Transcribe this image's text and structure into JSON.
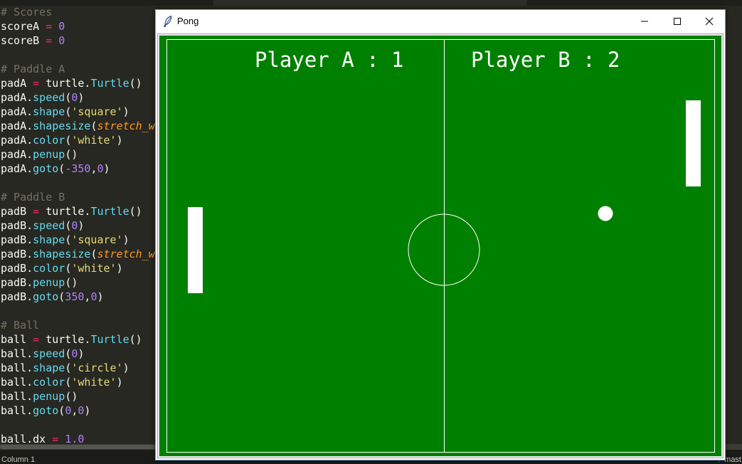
{
  "editor": {
    "code": [
      [
        [
          "cm",
          "# Scores"
        ]
      ],
      [
        [
          "id",
          "scoreA"
        ],
        [
          "p",
          " "
        ],
        [
          "op",
          "="
        ],
        [
          "p",
          " "
        ],
        [
          "num",
          "0"
        ]
      ],
      [
        [
          "id",
          "scoreB"
        ],
        [
          "p",
          " "
        ],
        [
          "op",
          "="
        ],
        [
          "p",
          " "
        ],
        [
          "num",
          "0"
        ]
      ],
      [],
      [
        [
          "cm",
          "# Paddle A"
        ]
      ],
      [
        [
          "id",
          "padA"
        ],
        [
          "p",
          " "
        ],
        [
          "op",
          "="
        ],
        [
          "p",
          " turtle."
        ],
        [
          "fn",
          "Turtle"
        ],
        [
          "p",
          "()"
        ]
      ],
      [
        [
          "id",
          "padA."
        ],
        [
          "fn",
          "speed"
        ],
        [
          "p",
          "("
        ],
        [
          "num",
          "0"
        ],
        [
          "p",
          ")"
        ]
      ],
      [
        [
          "id",
          "padA."
        ],
        [
          "fn",
          "shape"
        ],
        [
          "p",
          "("
        ],
        [
          "str",
          "'square'"
        ],
        [
          "p",
          ")"
        ]
      ],
      [
        [
          "id",
          "padA."
        ],
        [
          "fn",
          "shapesize"
        ],
        [
          "p",
          "("
        ],
        [
          "arg",
          "stretch_w"
        ]
      ],
      [
        [
          "id",
          "padA."
        ],
        [
          "fn",
          "color"
        ],
        [
          "p",
          "("
        ],
        [
          "str",
          "'white'"
        ],
        [
          "p",
          ")"
        ]
      ],
      [
        [
          "id",
          "padA."
        ],
        [
          "fn",
          "penup"
        ],
        [
          "p",
          "()"
        ]
      ],
      [
        [
          "id",
          "padA."
        ],
        [
          "fn",
          "goto"
        ],
        [
          "p",
          "("
        ],
        [
          "num",
          "-350"
        ],
        [
          "p",
          ","
        ],
        [
          "num",
          "0"
        ],
        [
          "p",
          ")"
        ]
      ],
      [],
      [
        [
          "cm",
          "# Paddle B"
        ]
      ],
      [
        [
          "id",
          "padB"
        ],
        [
          "p",
          " "
        ],
        [
          "op",
          "="
        ],
        [
          "p",
          " turtle."
        ],
        [
          "fn",
          "Turtle"
        ],
        [
          "p",
          "()"
        ]
      ],
      [
        [
          "id",
          "padB."
        ],
        [
          "fn",
          "speed"
        ],
        [
          "p",
          "("
        ],
        [
          "num",
          "0"
        ],
        [
          "p",
          ")"
        ]
      ],
      [
        [
          "id",
          "padB."
        ],
        [
          "fn",
          "shape"
        ],
        [
          "p",
          "("
        ],
        [
          "str",
          "'square'"
        ],
        [
          "p",
          ")"
        ]
      ],
      [
        [
          "id",
          "padB."
        ],
        [
          "fn",
          "shapesize"
        ],
        [
          "p",
          "("
        ],
        [
          "arg",
          "stretch_w"
        ]
      ],
      [
        [
          "id",
          "padB."
        ],
        [
          "fn",
          "color"
        ],
        [
          "p",
          "("
        ],
        [
          "str",
          "'white'"
        ],
        [
          "p",
          ")"
        ]
      ],
      [
        [
          "id",
          "padB."
        ],
        [
          "fn",
          "penup"
        ],
        [
          "p",
          "()"
        ]
      ],
      [
        [
          "id",
          "padB."
        ],
        [
          "fn",
          "goto"
        ],
        [
          "p",
          "("
        ],
        [
          "num",
          "350"
        ],
        [
          "p",
          ","
        ],
        [
          "num",
          "0"
        ],
        [
          "p",
          ")"
        ]
      ],
      [],
      [
        [
          "cm",
          "# Ball"
        ]
      ],
      [
        [
          "id",
          "ball"
        ],
        [
          "p",
          " "
        ],
        [
          "op",
          "="
        ],
        [
          "p",
          " turtle."
        ],
        [
          "fn",
          "Turtle"
        ],
        [
          "p",
          "()"
        ]
      ],
      [
        [
          "id",
          "ball."
        ],
        [
          "fn",
          "speed"
        ],
        [
          "p",
          "("
        ],
        [
          "num",
          "0"
        ],
        [
          "p",
          ")"
        ]
      ],
      [
        [
          "id",
          "ball."
        ],
        [
          "fn",
          "shape"
        ],
        [
          "p",
          "("
        ],
        [
          "str",
          "'circle'"
        ],
        [
          "p",
          ")"
        ]
      ],
      [
        [
          "id",
          "ball."
        ],
        [
          "fn",
          "color"
        ],
        [
          "p",
          "("
        ],
        [
          "str",
          "'white'"
        ],
        [
          "p",
          ")"
        ]
      ],
      [
        [
          "id",
          "ball."
        ],
        [
          "fn",
          "penup"
        ],
        [
          "p",
          "()"
        ]
      ],
      [
        [
          "id",
          "ball."
        ],
        [
          "fn",
          "goto"
        ],
        [
          "p",
          "("
        ],
        [
          "num",
          "0"
        ],
        [
          "p",
          ","
        ],
        [
          "num",
          "0"
        ],
        [
          "p",
          ")"
        ]
      ],
      [],
      [
        [
          "id",
          "ball.dx"
        ],
        [
          "p",
          " "
        ],
        [
          "op",
          "="
        ],
        [
          "p",
          " "
        ],
        [
          "num",
          "1.0"
        ]
      ]
    ],
    "status_column": "Column 1",
    "status_branch": "mast",
    "branch_icon": "git-branch-icon"
  },
  "window": {
    "title": "Pong",
    "app_icon": "feather-icon",
    "buttons": {
      "minimize_icon": "minimize-icon",
      "maximize_icon": "maximize-icon",
      "close_icon": "close-icon"
    }
  },
  "game": {
    "field_color": "#008000",
    "line_color": "#ffffff",
    "score_a_text": "Player A : 1",
    "score_b_text": "Player B : 2",
    "score_a": 1,
    "score_b": 2
  }
}
